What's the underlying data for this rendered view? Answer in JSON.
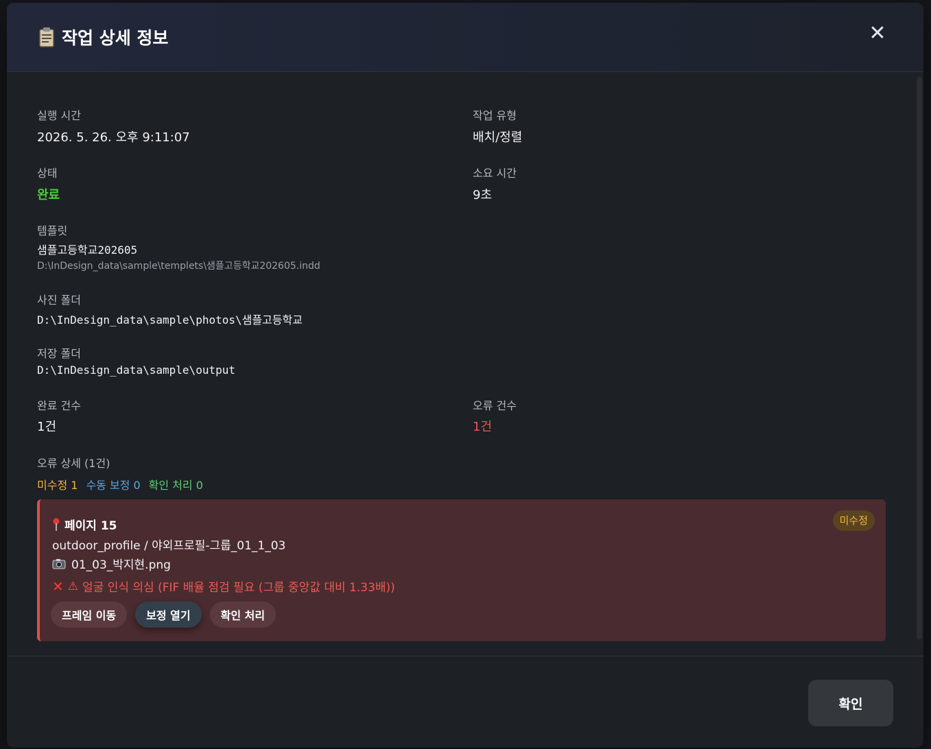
{
  "modal": {
    "title": "작업 상세 정보",
    "close_glyph": "✕"
  },
  "details": {
    "run_time_label": "실행 시간",
    "run_time_value": "2026. 5. 26. 오후 9:11:07",
    "job_type_label": "작업 유형",
    "job_type_value": "배치/정렬",
    "status_label": "상태",
    "status_value": "완료",
    "duration_label": "소요 시간",
    "duration_value": "9초",
    "template_label": "템플릿",
    "template_value": "샘플고등학교202605",
    "template_path": "D:\\InDesign_data\\sample\\templets\\샘플고등학교202605.indd",
    "photo_folder_label": "사진 폴더",
    "photo_folder_value": "D:\\InDesign_data\\sample\\photos\\샘플고등학교",
    "save_folder_label": "저장 폴더",
    "save_folder_value": "D:\\InDesign_data\\sample\\output",
    "done_count_label": "완료 건수",
    "done_count_value": "1건",
    "error_count_label": "오류 건수",
    "error_count_value": "1건",
    "error_detail_label": "오류 상세 (1건)"
  },
  "summary": {
    "unfixed": "미수정 1",
    "manual": "수동 보정 0",
    "confirmed": "확인 처리 0"
  },
  "error_item": {
    "page": "페이지 15",
    "badge": "미수정",
    "frame": "outdoor_profile / 야외프로필-그룹_01_1_03",
    "photo": "01_03_박지현.png",
    "message": "얼굴 인식 의심 (FIF 배율 점검 필요 (그룹 중앙값 대비 1.33배))",
    "buttons": {
      "move_frame": "프레임 이동",
      "open_correction": "보정 열기",
      "confirm": "확인 처리"
    }
  },
  "footer": {
    "ok_label": "확인"
  },
  "colors": {
    "status_green": "#4ccf3c",
    "error_red": "#ef5350",
    "badge_amber": "#f4b63a",
    "card_bg": "#4a2b2f"
  }
}
